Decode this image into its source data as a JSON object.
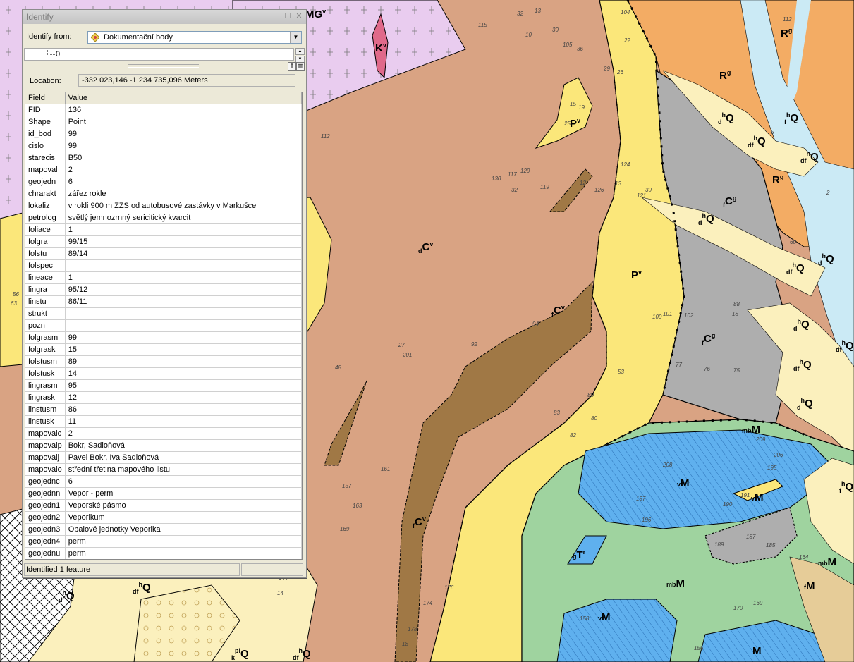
{
  "window": {
    "title": "Identify",
    "identify_from_label": "Identify from:",
    "identify_from_value": "Dokumentační body",
    "tree_value": "0",
    "location_label": "Location:",
    "location_value": "-332 023,146  -1 234 735,096 Meters",
    "status": "Identified 1 feature"
  },
  "grid": {
    "headers": [
      "Field",
      "Value"
    ],
    "rows": [
      [
        "FID",
        "136"
      ],
      [
        "Shape",
        "Point"
      ],
      [
        "id_bod",
        "99"
      ],
      [
        "cislo",
        "99"
      ],
      [
        "starecis",
        "B50"
      ],
      [
        "mapoval",
        "2"
      ],
      [
        "geojedn",
        "6"
      ],
      [
        "chrarakt",
        "zářez rokle"
      ],
      [
        "lokaliz",
        "v rokli 900 m ZZS od autobusové zastávky v Markušce"
      ],
      [
        "petrolog",
        "světlý jemnozrnný sericitický kvarcit"
      ],
      [
        "foliace",
        "1"
      ],
      [
        "folgra",
        "99/15"
      ],
      [
        "folstu",
        "89/14"
      ],
      [
        "folspec",
        ""
      ],
      [
        "lineace",
        "1"
      ],
      [
        "lingra",
        "95/12"
      ],
      [
        "linstu",
        "86/11"
      ],
      [
        "strukt",
        ""
      ],
      [
        "pozn",
        ""
      ],
      [
        "folgrasm",
        "99"
      ],
      [
        "folgrask",
        "15"
      ],
      [
        "folstusm",
        "89"
      ],
      [
        "folstusk",
        "14"
      ],
      [
        "lingrasm",
        "95"
      ],
      [
        "lingrask",
        "12"
      ],
      [
        "linstusm",
        "86"
      ],
      [
        "linstusk",
        "11"
      ],
      [
        "mapovalc",
        "2"
      ],
      [
        "mapovalp",
        "Bokr, Sadloňová"
      ],
      [
        "mapovalj",
        "Pavel Bokr, Iva Sadloňová"
      ],
      [
        "mapovalo",
        "střední třetina mapového listu"
      ],
      [
        "geojednc",
        "6"
      ],
      [
        "geojednn",
        "Vepor - perm"
      ],
      [
        "geojedn1",
        "Veporské pásmo"
      ],
      [
        "geojedn2",
        "Veporikum"
      ],
      [
        "geojedn3",
        "Obalové jednotky Veporika"
      ],
      [
        "geojedn4",
        "perm"
      ],
      [
        "geojednu",
        "perm"
      ]
    ]
  },
  "map": {
    "colors": {
      "brown": "#d9a383",
      "yellow": "#fbe77a",
      "orange": "#f3ac64",
      "gray": "#aeaeae",
      "lightblue": "#cbeaf5",
      "green": "#9fd39f",
      "blue": "#5fb0ee",
      "darkbrown": "#a07845",
      "cream": "#fbf0bd",
      "lavender": "#e9ccef",
      "pink": "#e0698a"
    },
    "labels": [
      {
        "main": "R",
        "sup": "g"
      },
      {
        "main": "R",
        "sup": "g"
      },
      {
        "main": "R",
        "sup": "g"
      },
      {
        "main": "P",
        "sup": "v"
      },
      {
        "main": "P",
        "sup": "v"
      },
      {
        "main": "C",
        "sup": "v",
        "pre": "d"
      },
      {
        "main": "C",
        "sup": "v",
        "pre": "f"
      },
      {
        "main": "C",
        "sup": "v",
        "pre": "f"
      },
      {
        "main": "C",
        "sup": "g",
        "pre": "f"
      },
      {
        "main": "C",
        "sup": "g",
        "pre": "f"
      },
      {
        "main": "K",
        "sup": "v"
      },
      {
        "main": "MG",
        "sup": "v"
      },
      {
        "main": "Q",
        "pre": "d",
        "sup": "h"
      },
      {
        "main": "Q",
        "pre": "f",
        "sup": "h"
      },
      {
        "main": "Q",
        "pre": "df",
        "sup": "h"
      },
      {
        "main": "Q",
        "pre": "df",
        "sup": "h"
      },
      {
        "main": "Q",
        "pre": "d",
        "sup": "h"
      },
      {
        "main": "Q",
        "pre": "df",
        "sup": "h"
      },
      {
        "main": "Q",
        "pre": "d",
        "sup": "h"
      },
      {
        "main": "Q",
        "pre": "df",
        "sup": "h"
      },
      {
        "main": "Q",
        "pre": "d",
        "sup": "h"
      },
      {
        "main": "Q",
        "pre": "f",
        "sup": "h"
      },
      {
        "main": "Q",
        "pre": "d",
        "sup": "h"
      },
      {
        "main": "Q",
        "pre": "df",
        "sup": "h"
      },
      {
        "main": "M",
        "pre": "mb"
      },
      {
        "main": "M",
        "pre": "v"
      },
      {
        "main": "M",
        "pre": "mb"
      },
      {
        "main": "M",
        "pre": "mb"
      },
      {
        "main": "M",
        "pre": "f"
      },
      {
        "main": "M",
        "pre": "v"
      },
      {
        "main": "M",
        "pre": "v"
      },
      {
        "main": "M"
      },
      {
        "main": "T",
        "pre": "g",
        "sup": "r"
      },
      {
        "main": "Q",
        "pre": "d",
        "sup": "h"
      },
      {
        "main": "Q",
        "pre": "df",
        "sup": "h"
      },
      {
        "main": "Q",
        "pre": "df",
        "sup": "h"
      },
      {
        "main": "Q",
        "pre": "k",
        "sup": "pl"
      }
    ],
    "numbers": [
      "115",
      "13",
      "32",
      "10",
      "30",
      "105",
      "36",
      "104",
      "112",
      "22",
      "29",
      "26",
      "19",
      "15",
      "25",
      "124",
      "129",
      "117",
      "130",
      "32",
      "119",
      "12",
      "126",
      "13",
      "30",
      "121",
      "2",
      "60",
      "100",
      "101",
      "102",
      "88",
      "18",
      "92",
      "27",
      "201",
      "94",
      "80",
      "75",
      "76",
      "77",
      "1",
      "48",
      "83",
      "82",
      "80",
      "161",
      "137",
      "163",
      "169",
      "144",
      "14",
      "174",
      "176",
      "178",
      "18",
      "206",
      "208",
      "209",
      "195",
      "197",
      "191",
      "196",
      "190",
      "189",
      "187",
      "185",
      "164",
      "170",
      "169",
      "158",
      "156",
      "53",
      "56",
      "63",
      "112",
      "5"
    ]
  }
}
